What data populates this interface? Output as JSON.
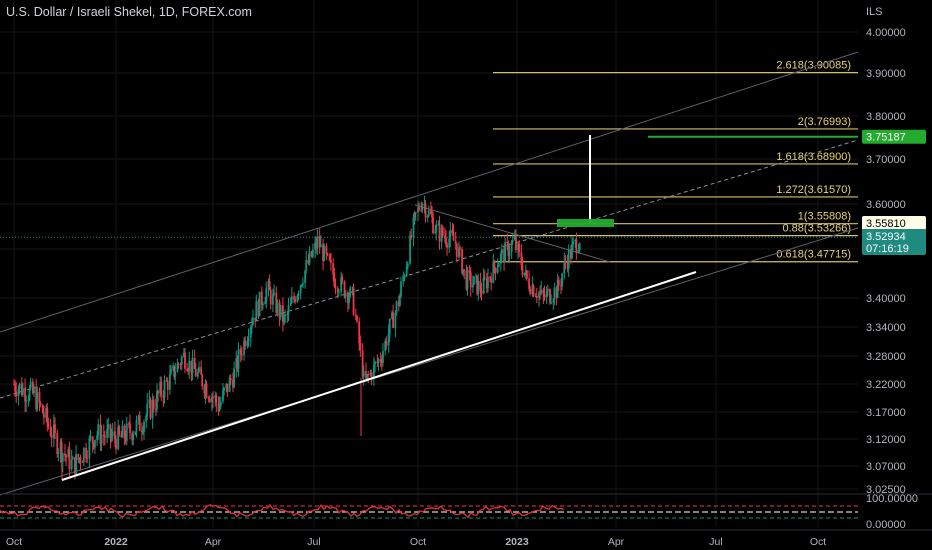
{
  "header": {
    "title": "U.S. Dollar / Israeli Shekel, 1D, FOREX.com"
  },
  "axis": {
    "unit": "ILS",
    "y_ticks": [
      "4.00000",
      "3.90000",
      "3.80000",
      "3.70000",
      "3.60000",
      "3.40000",
      "3.34000",
      "3.28000",
      "3.22000",
      "3.17000",
      "3.12000",
      "3.07000",
      "3.02500"
    ],
    "x_ticks": [
      "Oct",
      "2022",
      "Apr",
      "Jul",
      "Oct",
      "2023",
      "Apr",
      "Jul",
      "Oct"
    ],
    "osc_ticks": [
      "100.00000",
      "0.00000"
    ]
  },
  "price_badges": {
    "target": "3.75187",
    "level": "3.55810",
    "last": "3.52934",
    "countdown": "07:16:19"
  },
  "fib_levels": [
    {
      "label": "2.618(3.90085)",
      "value": 3.90085
    },
    {
      "label": "2(3.76993)",
      "value": 3.76993
    },
    {
      "label": "1.618(3.68900)",
      "value": 3.689
    },
    {
      "label": "1.272(3.61570)",
      "value": 3.6157
    },
    {
      "label": "1(3.55808)",
      "value": 3.55808
    },
    {
      "label": "0.88(3.53266)",
      "value": 3.53266
    },
    {
      "label": "0.618(3.47715)",
      "value": 3.47715
    }
  ],
  "colors": {
    "up": "#089981",
    "down": "#f23645",
    "fib": "#d4c06a",
    "target": "#22ab2e",
    "trend": "#ffffff",
    "osc": "#e0323a",
    "grid": "#161616"
  },
  "chart_data": {
    "type": "candlestick",
    "title": "U.S. Dollar / Israeli Shekel, 1D, FOREX.com",
    "x_range": [
      "2021-10",
      "2023-10"
    ],
    "ylim": [
      3.025,
      4.0
    ],
    "y_scale": "log",
    "grid": true,
    "close_path": [
      {
        "date": "2021-10-01",
        "value": 3.22
      },
      {
        "date": "2021-10-20",
        "value": 3.2
      },
      {
        "date": "2021-11-10",
        "value": 3.11
      },
      {
        "date": "2021-11-24",
        "value": 3.07
      },
      {
        "date": "2021-12-15",
        "value": 3.13
      },
      {
        "date": "2022-01-05",
        "value": 3.12
      },
      {
        "date": "2022-01-25",
        "value": 3.15
      },
      {
        "date": "2022-02-20",
        "value": 3.23
      },
      {
        "date": "2022-03-05",
        "value": 3.28
      },
      {
        "date": "2022-03-25",
        "value": 3.22
      },
      {
        "date": "2022-04-07",
        "value": 3.18
      },
      {
        "date": "2022-04-20",
        "value": 3.24
      },
      {
        "date": "2022-05-05",
        "value": 3.35
      },
      {
        "date": "2022-05-20",
        "value": 3.42
      },
      {
        "date": "2022-06-05",
        "value": 3.35
      },
      {
        "date": "2022-06-20",
        "value": 3.44
      },
      {
        "date": "2022-07-05",
        "value": 3.52
      },
      {
        "date": "2022-07-20",
        "value": 3.44
      },
      {
        "date": "2022-08-05",
        "value": 3.4
      },
      {
        "date": "2022-08-15",
        "value": 3.22
      },
      {
        "date": "2022-08-30",
        "value": 3.28
      },
      {
        "date": "2022-09-15",
        "value": 3.4
      },
      {
        "date": "2022-09-28",
        "value": 3.56
      },
      {
        "date": "2022-10-05",
        "value": 3.61
      },
      {
        "date": "2022-10-20",
        "value": 3.54
      },
      {
        "date": "2022-11-05",
        "value": 3.52
      },
      {
        "date": "2022-11-15",
        "value": 3.44
      },
      {
        "date": "2022-11-30",
        "value": 3.42
      },
      {
        "date": "2022-12-15",
        "value": 3.48
      },
      {
        "date": "2022-12-30",
        "value": 3.52
      },
      {
        "date": "2023-01-10",
        "value": 3.44
      },
      {
        "date": "2023-01-25",
        "value": 3.4
      },
      {
        "date": "2023-02-08",
        "value": 3.42
      },
      {
        "date": "2023-02-15",
        "value": 3.48
      },
      {
        "date": "2023-02-28",
        "value": 3.53
      }
    ],
    "last_price": 3.52934,
    "target_price": 3.75187,
    "fib_levels": [
      3.90085,
      3.76993,
      3.689,
      3.6157,
      3.55808,
      3.53266,
      3.47715
    ],
    "oscillator": {
      "ylim": [
        0,
        100
      ]
    }
  }
}
